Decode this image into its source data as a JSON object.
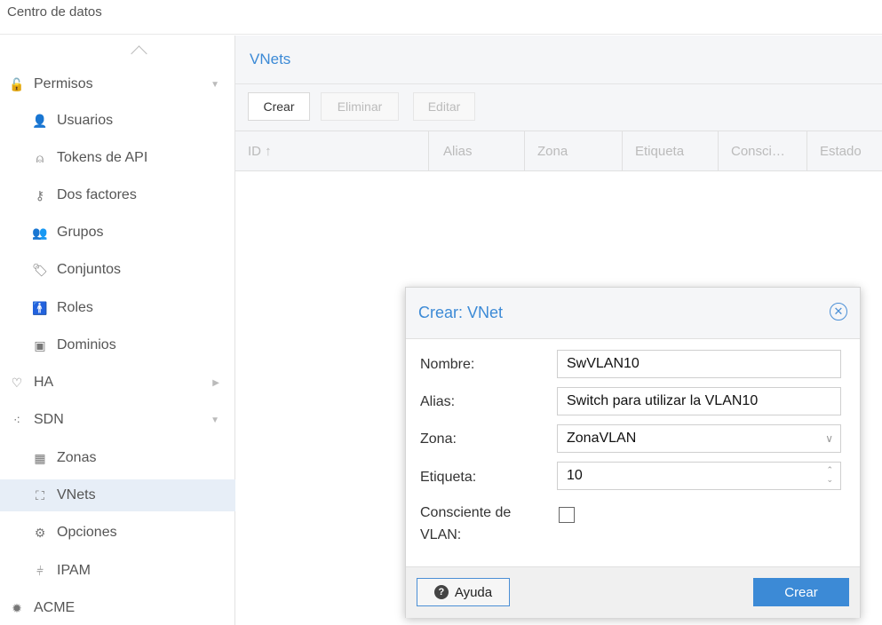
{
  "breadcrumb": "Centro de datos",
  "sidebar": {
    "items": [
      {
        "label": "Permisos",
        "icon": "lock-open-icon"
      },
      {
        "label": "Usuarios",
        "icon": "user-icon"
      },
      {
        "label": "Tokens de API",
        "icon": "token-user-icon"
      },
      {
        "label": "Dos factores",
        "icon": "key-icon"
      },
      {
        "label": "Grupos",
        "icon": "group-icon"
      },
      {
        "label": "Conjuntos",
        "icon": "tags-icon"
      },
      {
        "label": "Roles",
        "icon": "person-icon"
      },
      {
        "label": "Dominios",
        "icon": "id-card-icon"
      },
      {
        "label": "HA",
        "icon": "heartbeat-icon"
      },
      {
        "label": "SDN",
        "icon": "network-icon"
      },
      {
        "label": "Zonas",
        "icon": "grid-icon"
      },
      {
        "label": "VNets",
        "icon": "sitemap-icon"
      },
      {
        "label": "Opciones",
        "icon": "gear-icon"
      },
      {
        "label": "IPAM",
        "icon": "ipam-icon"
      },
      {
        "label": "ACME",
        "icon": "certificate-icon"
      }
    ]
  },
  "main": {
    "title": "VNets",
    "toolbar": {
      "create": "Crear",
      "delete": "Eliminar",
      "edit": "Editar"
    },
    "columns": [
      "ID ↑",
      "Alias",
      "Zona",
      "Etiqueta",
      "Consci…",
      "Estado"
    ]
  },
  "dialog": {
    "title": "Crear: VNet",
    "fields": {
      "name_label": "Nombre:",
      "name_value": "SwVLAN10",
      "alias_label": "Alias:",
      "alias_value": "Switch para utilizar la VLAN10",
      "zone_label": "Zona:",
      "zone_value": "ZonaVLAN",
      "tag_label": "Etiqueta:",
      "tag_value": "10",
      "vlan_aware_label_1": "Consciente de",
      "vlan_aware_label_2": "VLAN:"
    },
    "help": "Ayuda",
    "create": "Crear"
  }
}
